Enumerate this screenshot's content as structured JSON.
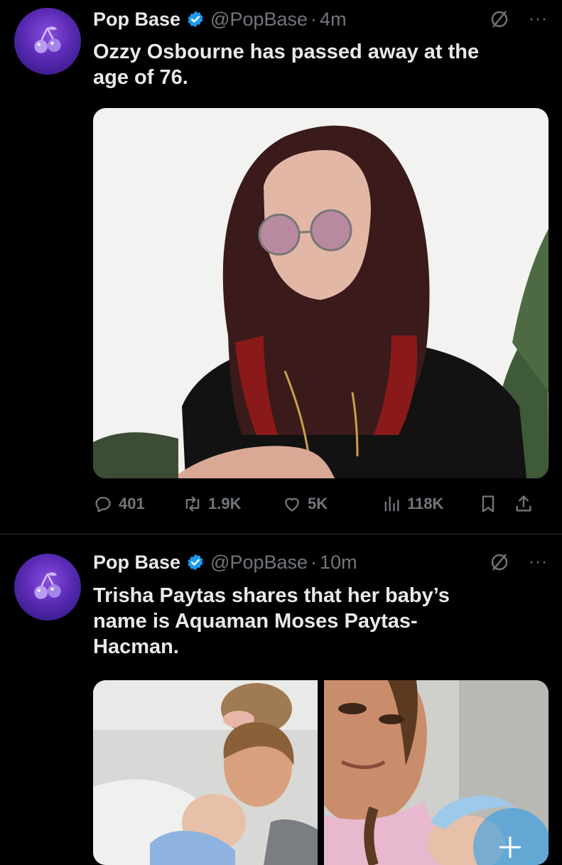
{
  "tweets": [
    {
      "name": "Pop Base",
      "handle": "@PopBase",
      "time": "4m",
      "text": "Ozzy Osbourne has passed away at the\nage  of 76.",
      "stats": {
        "replies": "401",
        "reposts": "1.9K",
        "likes": "5K",
        "views": "118K"
      }
    },
    {
      "name": "Pop Base",
      "handle": "@PopBase",
      "time": "10m",
      "text": "Trisha Paytas shares that her baby’s\nname is Aquaman Moses Paytas-\nHacman."
    }
  ],
  "separator": "·",
  "more_glyph": "···",
  "colors": {
    "background": "#000000",
    "text": "#e7e9ea",
    "muted": "#71767b",
    "verified": "#1d9bf0",
    "avatar": "#5b2bb5"
  },
  "icons": [
    "cherry-avatar-icon",
    "verified-badge-icon",
    "grok-icon",
    "more-icon",
    "reply-icon",
    "repost-icon",
    "like-icon",
    "views-icon",
    "bookmark-icon",
    "share-icon"
  ]
}
